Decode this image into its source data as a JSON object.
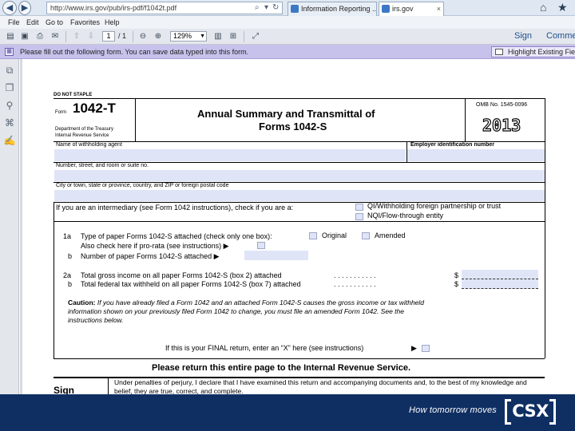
{
  "browser": {
    "address": "http://www.irs.gov/pub/irs-pdf/f1042t.pdf",
    "tabs": [
      {
        "label": "Information Reporting ..."
      },
      {
        "label": "irs.gov"
      }
    ],
    "menu": [
      "File",
      "Edit",
      "Go to",
      "Favorites",
      "Help"
    ],
    "icons": [
      "back-icon",
      "forward-icon",
      "search-icon",
      "refresh-icon",
      "home-icon",
      "favorites-star-icon"
    ]
  },
  "pdf_toolbar": {
    "page_current": "1",
    "page_total": "/ 1",
    "zoom": "129%",
    "sign_label": "Sign",
    "comment_label": "Comme"
  },
  "notice": {
    "text": "Please fill out the following form. You can save data typed into this form.",
    "highlight_label": "Highlight Existing Field"
  },
  "form": {
    "do_not_staple": "DO NOT STAPLE",
    "form_word": "Form",
    "form_number": "1042-T",
    "dept_line1": "Department of the Treasury",
    "dept_line2": "Internal Revenue Service",
    "title_line1": "Annual Summary and Transmittal of",
    "title_line2": "Forms 1042-S",
    "omb": "OMB No. 1545-0096",
    "year": "2013",
    "agent_label": "Name of withholding agent",
    "ein_label": "Employer identification number",
    "street_label": "Number, street, and room or suite no.",
    "city_label": "City or town, state or province, country, and ZIP or foreign postal code",
    "intermediary_text": "If you are an intermediary (see Form 1042 instructions), check if you are a:",
    "qi_label": "QI/Withholding foreign partnership or trust",
    "nqi_label": "NQI/Flow-through entity",
    "line1a_num": "1a",
    "line1a_text": "Type of paper Forms 1042-S attached (check only one box):",
    "original_label": "Original",
    "amended_label": "Amended",
    "prorata_text": "Also check here if pro-rata (see instructions) ▶",
    "line1b_num": "b",
    "line1b_text": "Number of paper Forms 1042-S attached ▶",
    "line2a_num": "2a",
    "line2a_text": "Total gross income on all paper Forms 1042-S (box 2) attached",
    "line2b_num": "b",
    "line2b_text": "Total federal tax withheld on all paper Forms 1042-S (box 7) attached",
    "dots": ". . . . . . . . . . .",
    "dollar": "$",
    "caution_bold": "Caution:",
    "caution_line1": "If you have already filed a Form 1042 and an attached Form 1042-S causes the gross income or tax withheld",
    "caution_line2": "information shown on your previously filed Form 1042 to change, you must file an amended Form 1042. See the",
    "caution_line3": "instructions below.",
    "final_text": "If this is your FINAL return, enter an “X” here (see instructions)",
    "final_arrow": "▶",
    "return_text": "Please return this entire page to the Internal Revenue Service.",
    "sign_label": "Sign",
    "perjury_line1": "Under penalties of perjury, I declare that I have examined this return and accompanying documents and, to the best of my knowledge and",
    "perjury_line2": "belief, they are true, correct, and complete."
  },
  "footer": {
    "tagline": "How tomorrow moves",
    "logo": "CSX"
  },
  "colors": {
    "field_fill": "#dfe5f7",
    "notice_bar": "#c7c2ec",
    "footer_bg": "#0f2f63"
  }
}
